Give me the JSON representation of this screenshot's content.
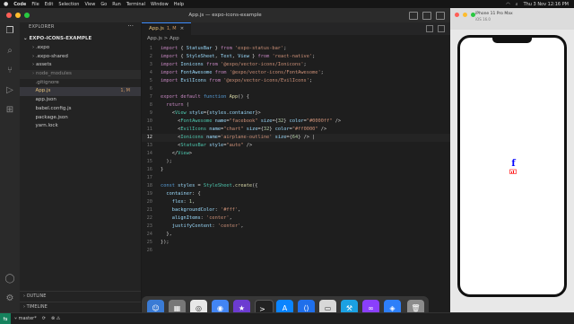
{
  "menubar": {
    "apple": "",
    "items": [
      "Code",
      "File",
      "Edit",
      "Selection",
      "View",
      "Go",
      "Run",
      "Terminal",
      "Window",
      "Help"
    ],
    "datetime": "Thu 3 Nov 12:16 PM"
  },
  "window": {
    "title": "App.js — expo-icons-example"
  },
  "explorer": {
    "header": "EXPLORER",
    "project": "EXPO-ICONS-EXAMPLE",
    "items": [
      {
        "label": ".expo",
        "badge": ""
      },
      {
        "label": ".expo-shared",
        "badge": ""
      },
      {
        "label": "assets",
        "badge": ""
      },
      {
        "label": "node_modules",
        "badge": ""
      },
      {
        "label": ".gitignore",
        "badge": ""
      },
      {
        "label": "App.js",
        "badge": "1, M"
      },
      {
        "label": "app.json",
        "badge": ""
      },
      {
        "label": "babel.config.js",
        "badge": ""
      },
      {
        "label": "package.json",
        "badge": ""
      },
      {
        "label": "yarn.lock",
        "badge": ""
      }
    ],
    "outline": "OUTLINE",
    "timeline": "TIMELINE"
  },
  "editor": {
    "tab_label": "App.js",
    "tab_badge": "1, M",
    "breadcrumb": "App.js > App",
    "current_line": 12
  },
  "simulator": {
    "title": "iPhone 11 Pro Max",
    "subtitle": "iOS 16.0"
  },
  "statusbar": {
    "branch": "master*"
  },
  "colors": {
    "accent": "#3c8cff",
    "facebook_icon": "#0000ff",
    "chart_icon": "#ff0000"
  }
}
